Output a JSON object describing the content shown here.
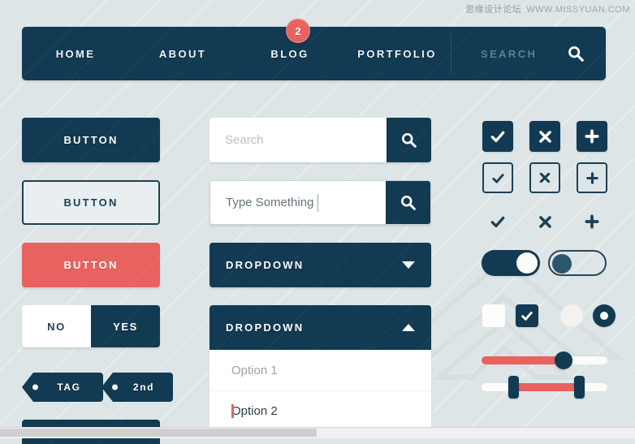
{
  "watermark": {
    "cn": "思缘设计论坛",
    "url": "WWW.MISSYUAN.COM"
  },
  "colors": {
    "navy": "#123a52",
    "red": "#e8635f",
    "background": "#dde5e7",
    "white": "#ffffff",
    "muted_text": "#9ba5a9"
  },
  "navbar": {
    "links": [
      {
        "label": "HOME"
      },
      {
        "label": "ABOUT"
      },
      {
        "label": "BLOG"
      },
      {
        "label": "PORTFOLIO"
      }
    ],
    "badge": {
      "count": "2",
      "on_link": "BLOG"
    },
    "search": {
      "placeholder": "SEARCH",
      "icon": "search-icon"
    }
  },
  "buttons": {
    "solid": "BUTTON",
    "outline": "BUTTON",
    "red": "BUTTON"
  },
  "segmented": {
    "off_label": "NO",
    "on_label": "YES",
    "selected": "YES"
  },
  "tags": [
    {
      "label": "TAG"
    },
    {
      "label": "2nd"
    }
  ],
  "search_fields": [
    {
      "placeholder": "Search",
      "value": "",
      "icon": "search-icon"
    },
    {
      "placeholder": "",
      "value": "Type Something",
      "icon": "search-icon",
      "focused": true
    }
  ],
  "dropdowns": [
    {
      "label": "DROPDOWN",
      "state": "closed",
      "caret": "chevron-down-icon",
      "options": []
    },
    {
      "label": "DROPDOWN",
      "state": "open",
      "caret": "chevron-up-icon",
      "options": [
        {
          "label": "Option 1",
          "active": false
        },
        {
          "label": "Option 2",
          "active": true
        }
      ]
    }
  ],
  "icon_grid": {
    "rows": [
      {
        "style": "filled",
        "icons": [
          "check-icon",
          "close-icon",
          "plus-icon"
        ]
      },
      {
        "style": "outlined",
        "icons": [
          "check-icon",
          "close-icon",
          "plus-icon"
        ]
      },
      {
        "style": "bare",
        "icons": [
          "check-icon",
          "close-icon",
          "plus-icon"
        ]
      }
    ]
  },
  "toggles": [
    {
      "name": "toggle-on",
      "state": "on",
      "style": "filled"
    },
    {
      "name": "toggle-off",
      "state": "off",
      "style": "outlined"
    }
  ],
  "choice_row": [
    {
      "type": "checkbox",
      "checked": false
    },
    {
      "type": "checkbox",
      "checked": true
    },
    {
      "type": "radio",
      "checked": false
    },
    {
      "type": "radio",
      "checked": true
    }
  ],
  "sliders": [
    {
      "type": "single",
      "value": 65,
      "min": 0,
      "max": 100
    },
    {
      "type": "range",
      "low": 25,
      "high": 78,
      "min": 0,
      "max": 100
    }
  ]
}
